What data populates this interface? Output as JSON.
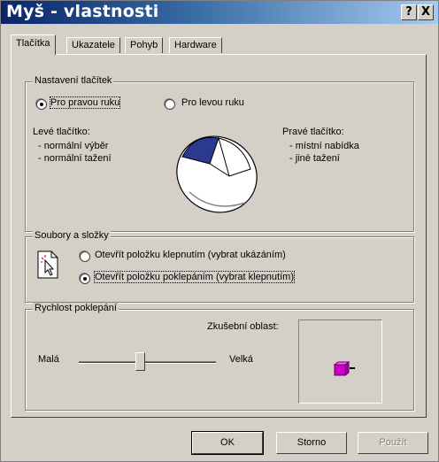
{
  "window": {
    "title": "Myš - vlastnosti",
    "help_label": "?",
    "close_label": "X"
  },
  "tabs": [
    {
      "label": "Tlačítka",
      "active": true
    },
    {
      "label": "Ukazatele",
      "active": false
    },
    {
      "label": "Pohyb",
      "active": false
    },
    {
      "label": "Hardware",
      "active": false
    }
  ],
  "buttons_group": {
    "title": "Nastavení tlačítek",
    "radio_right": "Pro pravou ruku",
    "radio_left": "Pro levou ruku",
    "selected": "right",
    "left_heading": "Levé tlačítko:",
    "left_lines": [
      "- normální výběr",
      "- normální tažení"
    ],
    "right_heading": "Pravé tlačítko:",
    "right_lines": [
      "- místní nabídka",
      "- jiné tažení"
    ]
  },
  "files_group": {
    "title": "Soubory a složky",
    "option_single": "Otevřít položku klepnutím (vybrat ukázáním)",
    "option_double": "Otevřít položku poklepáním (vybrat klepnutím)",
    "selected": "double"
  },
  "speed_group": {
    "title": "Rychlost poklepání",
    "slow_label": "Malá",
    "fast_label": "Velká",
    "test_area_label": "Zkušební oblast:",
    "slider_value_fraction": 0.45
  },
  "footer": {
    "ok_label": "OK",
    "cancel_label": "Storno",
    "apply_label": "Použít"
  },
  "colors": {
    "title_gradient_start": "#0a246a",
    "title_gradient_end": "#a6caf0",
    "dialog_face": "#d4d0c8",
    "mouse_button_highlight": "#2b3a8f",
    "test_object": "#cc00cc"
  }
}
